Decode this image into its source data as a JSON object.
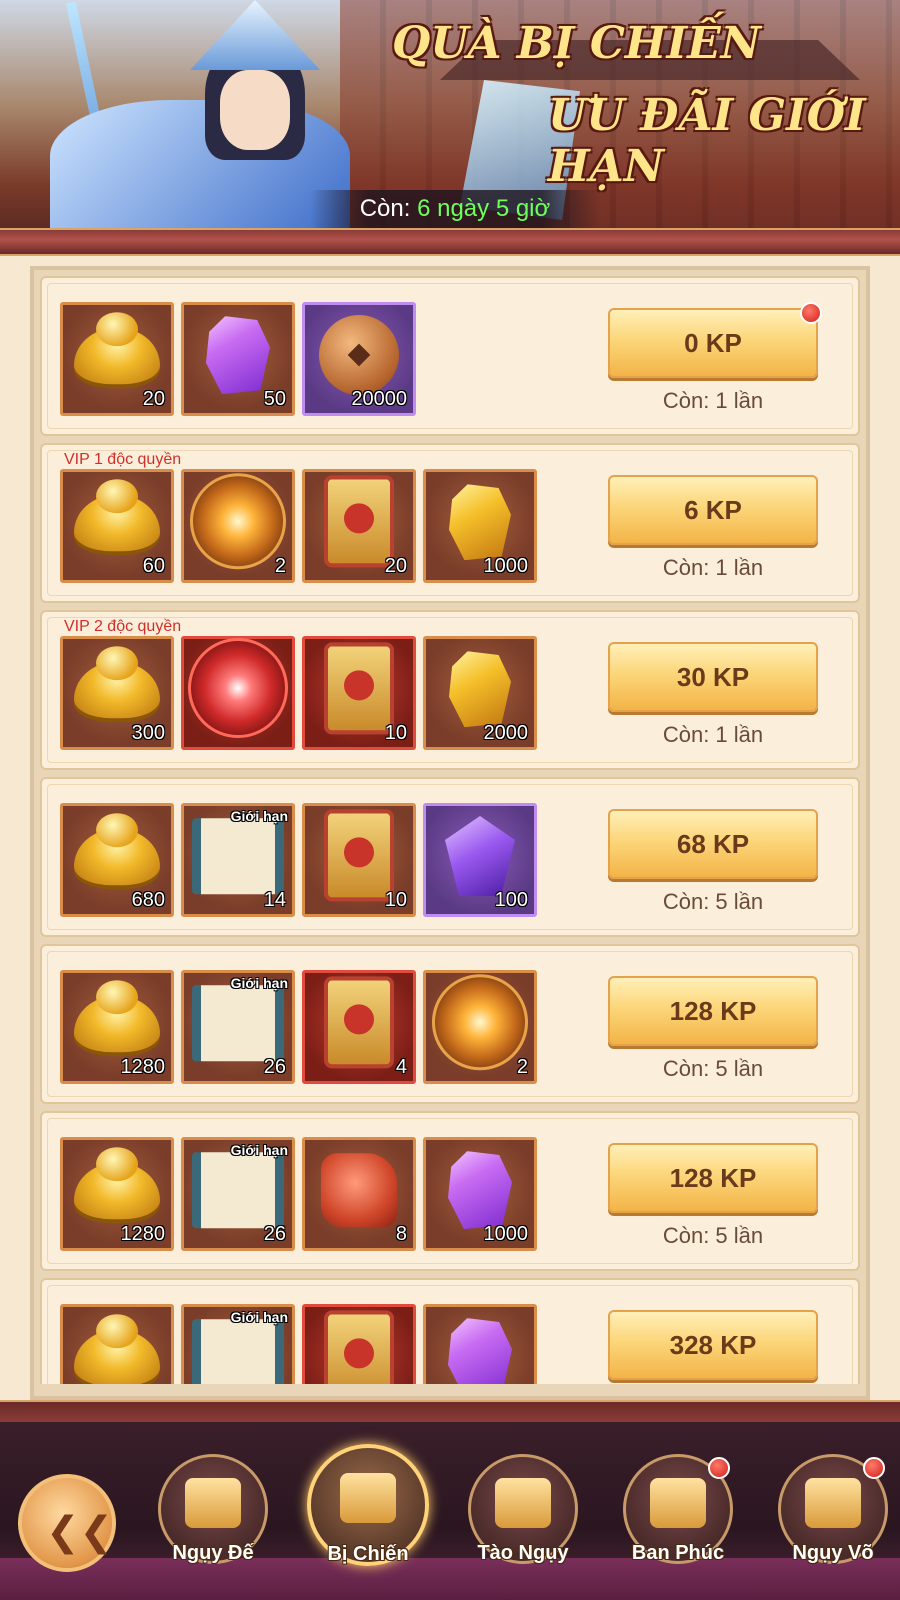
{
  "banner": {
    "title_line1": "QUÀ BỊ CHIẾN",
    "title_line2": "ƯU ĐÃI GIỚI HẠN",
    "timer_prefix": "Còn:",
    "timer_value": "6 ngày 5 giờ"
  },
  "packages": [
    {
      "vip": "",
      "items": [
        {
          "icon": "gold-ingot-icon",
          "qty": "20",
          "frame": "brown"
        },
        {
          "icon": "purple-gem-icon",
          "qty": "50",
          "frame": "brown"
        },
        {
          "icon": "bronze-coin-icon",
          "qty": "20000",
          "frame": "purple"
        }
      ],
      "price": "0 KP",
      "remaining": "Còn: 1 lần",
      "has_dot": true
    },
    {
      "vip": "VIP 1 độc quyền",
      "items": [
        {
          "icon": "gold-ingot-icon",
          "qty": "60",
          "frame": "brown"
        },
        {
          "icon": "golden-orb-icon",
          "qty": "2",
          "frame": "brown"
        },
        {
          "icon": "golden-token-icon",
          "qty": "20",
          "frame": "brown"
        },
        {
          "icon": "yellow-crystal-icon",
          "qty": "1000",
          "frame": "brown"
        }
      ],
      "price": "6 KP",
      "remaining": "Còn: 1 lần",
      "has_dot": false
    },
    {
      "vip": "VIP 2 độc quyền",
      "items": [
        {
          "icon": "gold-ingot-icon",
          "qty": "300",
          "frame": "brown"
        },
        {
          "icon": "red-orb-icon",
          "qty": "",
          "frame": "red"
        },
        {
          "icon": "red-token-icon",
          "qty": "10",
          "frame": "red"
        },
        {
          "icon": "yellow-crystal-icon",
          "qty": "2000",
          "frame": "brown"
        }
      ],
      "price": "30 KP",
      "remaining": "Còn: 1 lần",
      "has_dot": false
    },
    {
      "vip": "",
      "items": [
        {
          "icon": "gold-ingot-icon",
          "qty": "680",
          "frame": "brown"
        },
        {
          "icon": "scroll-icon",
          "qty": "14",
          "frame": "brown",
          "tag": "Giới hạn"
        },
        {
          "icon": "golden-token-icon",
          "qty": "10",
          "frame": "brown"
        },
        {
          "icon": "violet-crystal-icon",
          "qty": "100",
          "frame": "purple"
        }
      ],
      "price": "68 KP",
      "remaining": "Còn: 5 lần",
      "has_dot": false
    },
    {
      "vip": "",
      "items": [
        {
          "icon": "gold-ingot-icon",
          "qty": "1280",
          "frame": "brown"
        },
        {
          "icon": "scroll-icon",
          "qty": "26",
          "frame": "brown",
          "tag": "Giới hạn"
        },
        {
          "icon": "red-token-icon",
          "qty": "4",
          "frame": "red"
        },
        {
          "icon": "golden-orb-icon",
          "qty": "2",
          "frame": "brown"
        }
      ],
      "price": "128 KP",
      "remaining": "Còn: 5 lần",
      "has_dot": false
    },
    {
      "vip": "",
      "items": [
        {
          "icon": "gold-ingot-icon",
          "qty": "1280",
          "frame": "brown"
        },
        {
          "icon": "scroll-icon",
          "qty": "26",
          "frame": "brown",
          "tag": "Giới hạn"
        },
        {
          "icon": "red-pack-icon",
          "qty": "8",
          "frame": "brown"
        },
        {
          "icon": "purple-gem-icon",
          "qty": "1000",
          "frame": "brown"
        }
      ],
      "price": "128 KP",
      "remaining": "Còn: 5 lần",
      "has_dot": false
    },
    {
      "vip": "",
      "items": [
        {
          "icon": "gold-ingot-icon",
          "qty": "",
          "frame": "brown"
        },
        {
          "icon": "scroll-icon",
          "qty": "",
          "frame": "brown",
          "tag": "Giới hạn"
        },
        {
          "icon": "red-token-icon",
          "qty": "",
          "frame": "red"
        },
        {
          "icon": "purple-gem-icon",
          "qty": "",
          "frame": "brown"
        }
      ],
      "price": "328 KP",
      "remaining": "",
      "has_dot": false
    }
  ],
  "nav": {
    "back_icon": "back-arrow-icon",
    "tabs": [
      {
        "label": "Ngụy Đế",
        "icon": "palace-icon",
        "active": false,
        "dot": false
      },
      {
        "label": "Bị Chiến",
        "icon": "gift-box-icon",
        "active": true,
        "dot": false
      },
      {
        "label": "Tào Ngụy",
        "icon": "treasure-ingots-icon",
        "active": false,
        "dot": false
      },
      {
        "label": "Ban Phúc",
        "icon": "chest-icon",
        "active": false,
        "dot": true
      },
      {
        "label": "Ngụy Võ",
        "icon": "money-bag-icon",
        "active": false,
        "dot": true
      }
    ]
  },
  "colors": {
    "timer_highlight": "#6dff5a",
    "vip_text": "#d0302a",
    "button_gold": "#fcd67a"
  }
}
